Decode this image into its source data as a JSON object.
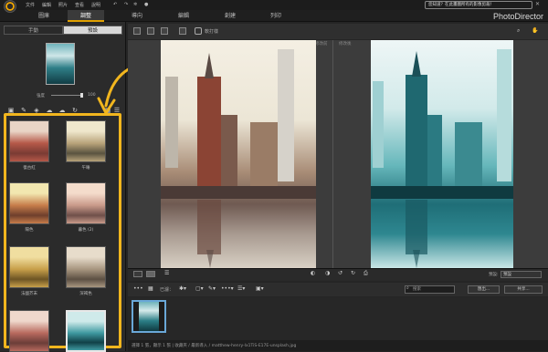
{
  "app": {
    "brand": "PhotoDirector"
  },
  "menu": {
    "file": "文件",
    "edit": "編輯",
    "photo": "照片",
    "view": "查看",
    "help": "說明"
  },
  "notice": "您知道？在此畫圖所有的影像剪裁！",
  "modes": {
    "library": "圖庫",
    "adjust": "調整",
    "guided": "導向",
    "edit": "編輯",
    "create": "創建",
    "print": "列印"
  },
  "subtabs": {
    "manual": "手動",
    "preset": "預設"
  },
  "strength": {
    "label": "強度",
    "value": "100"
  },
  "presets": [
    {
      "label": "復古紅",
      "colors": [
        "#e9d5c6",
        "#b55848",
        "#7a3b34"
      ]
    },
    {
      "label": "午睡",
      "colors": [
        "#efe7cc",
        "#b8a37a",
        "#5a5340"
      ]
    },
    {
      "label": "陽色",
      "colors": [
        "#f2e7b0",
        "#c77d4a",
        "#6e3f2c"
      ]
    },
    {
      "label": "暮色 (2)",
      "colors": [
        "#f4dccb",
        "#c99a8a",
        "#6f4f4a"
      ]
    },
    {
      "label": "法國芥末",
      "colors": [
        "#f0dea0",
        "#c8a04a",
        "#6d5424"
      ]
    },
    {
      "label": "深褐色",
      "colors": [
        "#e7dccb",
        "#a89680",
        "#5c5043"
      ]
    },
    {
      "label": "",
      "colors": [
        "#efd8cc",
        "#b86a5e",
        "#6b3d38"
      ]
    },
    {
      "label": "",
      "colors": [
        "#cfeaea",
        "#3f9aa1",
        "#114047"
      ]
    }
  ],
  "toolbar": {
    "softproof": "軟打樣"
  },
  "view": {
    "before": "修改前",
    "after": "修改後"
  },
  "viewbar": {
    "preset_label": "預設:",
    "preset_value": "預設"
  },
  "filmbar": {
    "filter_label": "已濾：",
    "search_placeholder": "搜索",
    "export": "匯出...",
    "share": "共享..."
  },
  "status": "選擇 1 張，顯示 1 張   |   收藏夾 / 最新導入 / matthew-henry-lx1TiS-E17E-unsplash.jpg",
  "colors": {
    "accent": "#f2b61e",
    "selection": "#6aa8d8"
  }
}
